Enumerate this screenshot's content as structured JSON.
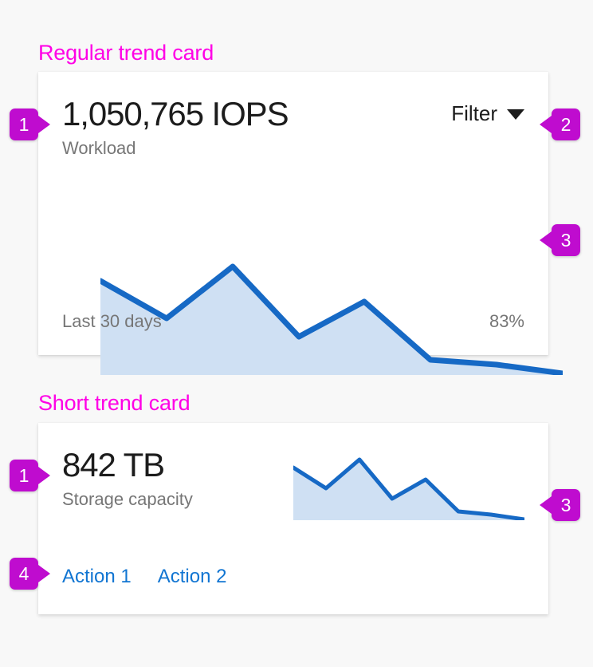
{
  "page": {
    "background_color": "#f8f8f8",
    "accent_color": "#ff00e6",
    "callout_color": "#bf0ccf",
    "link_color": "#1175d2"
  },
  "sections": {
    "regular": {
      "title": "Regular trend card"
    },
    "short": {
      "title": "Short trend card"
    }
  },
  "regular_card": {
    "metric_value": "1,050,765 IOPS",
    "metric_label": "Workload",
    "filter_label": "Filter",
    "filter_icon": "chevron-down-icon",
    "footer_left": "Last 30 days",
    "footer_right": "83%"
  },
  "short_card": {
    "metric_value": "842 TB",
    "metric_label": "Storage capacity",
    "action_1": "Action 1",
    "action_2": "Action 2"
  },
  "callouts": {
    "regular_value": "1",
    "regular_filter": "2",
    "regular_chart": "3",
    "short_value": "1",
    "short_chart": "3",
    "short_actions": "4"
  },
  "chart_data": [
    {
      "type": "area",
      "name": "regular-trend-chart",
      "title": "Workload",
      "xlabel": "Last 30 days",
      "ylabel": "",
      "grid": false,
      "legend": null,
      "line_color": "#1669c5",
      "fill_color": "#cfe0f3",
      "x": [
        0,
        1,
        2,
        3,
        4,
        5,
        6,
        7
      ],
      "xlim": [
        0,
        7
      ],
      "ylim": [
        0,
        100
      ],
      "values": [
        82,
        52,
        100,
        36,
        68,
        14,
        10,
        4
      ],
      "annotations": [
        "Last 30 days",
        "83%"
      ]
    },
    {
      "type": "area",
      "name": "short-trend-chart",
      "title": "Storage capacity",
      "xlabel": "",
      "ylabel": "",
      "grid": false,
      "legend": null,
      "line_color": "#1669c5",
      "fill_color": "#cfe0f3",
      "x": [
        0,
        1,
        2,
        3,
        4,
        5,
        6,
        7
      ],
      "xlim": [
        0,
        7
      ],
      "ylim": [
        0,
        100
      ],
      "values": [
        82,
        52,
        100,
        36,
        68,
        14,
        10,
        4
      ],
      "annotations": []
    }
  ]
}
